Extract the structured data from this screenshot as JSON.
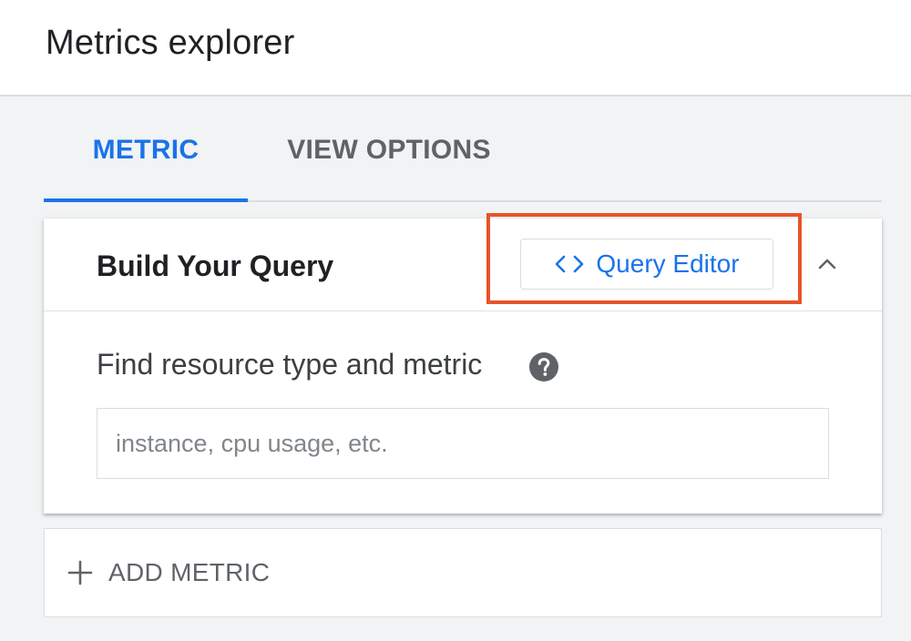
{
  "header": {
    "title": "Metrics explorer"
  },
  "tabs": [
    {
      "label": "METRIC",
      "active": true
    },
    {
      "label": "VIEW OPTIONS",
      "active": false
    }
  ],
  "query_card": {
    "title": "Build Your Query",
    "query_editor_label": "Query Editor",
    "query_editor_icon": "code-icon",
    "collapse_icon": "chevron-up-icon",
    "resource_label": "Find resource type and metric",
    "help_icon": "help-icon",
    "search": {
      "placeholder": "instance, cpu usage, etc.",
      "value": ""
    }
  },
  "add_metric": {
    "label": "ADD METRIC",
    "icon": "plus-icon"
  },
  "colors": {
    "accent": "#1a73e8",
    "highlight": "#e8542a",
    "text_primary": "#202124",
    "text_secondary": "#5f6368"
  }
}
